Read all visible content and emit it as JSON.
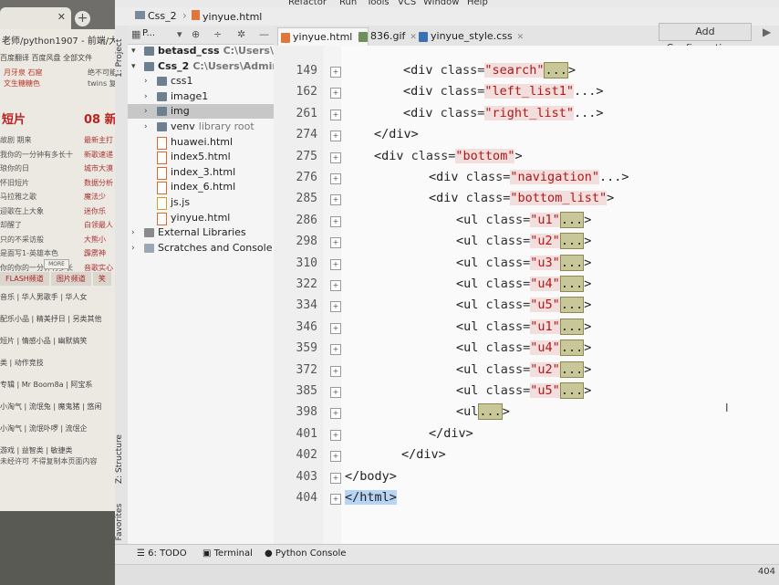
{
  "browser": {
    "url": "老师/python1907 - 前端/大作业",
    "bookmarks": "百度翻译  百度风盘 全部文件",
    "side_links": [
      "月牙泉 石窟",
      "文生糖糖色"
    ],
    "side_links_right": [
      "绝不可能",
      "twins 复"
    ],
    "header_left": "短片",
    "header_right": "08 新",
    "rows": [
      {
        "l": "故剧 期来",
        "r": "最新主打"
      },
      {
        "l": "我你的一分钟有多长十",
        "r": "新歌速递"
      },
      {
        "l": "琅你的日",
        "r": "城市大漠"
      },
      {
        "l": "怀旧短片",
        "r": "数据分析"
      },
      {
        "l": "马拉雅之歌",
        "r": "魔法少"
      },
      {
        "l": "迎歌在上大象",
        "r": "迷你乐"
      },
      {
        "l": "却醒了",
        "r": "白领最人"
      },
      {
        "l": "只的不采访般",
        "r": "大熊小"
      },
      {
        "l": "是面写1-英雄本色",
        "r": "霹雳神"
      },
      {
        "l": "你的你的一分钟有多长",
        "r": "音歌实心"
      }
    ],
    "more": "MORE",
    "tabs": [
      "FLASH频道",
      "图片频道",
      "笑"
    ],
    "categories": [
      "音乐 | 华人男歌手 | 华人女",
      "配乐小品 | 精美抒日 | 另类其他",
      "短片 | 情感小品 | 幽默搞笑",
      "类 | 动作竞技",
      "专辑 | Mr Boom8a | 阿宝系",
      "小淘气 | 流氓兔 | 魔鬼猪 | 悠闲",
      "小淘气 | 流氓卟啰 | 流氓企",
      "游戏 | 益智类 | 敏捷类"
    ],
    "footer": "未经许可 不得复制本页面内容"
  },
  "ide": {
    "menu": [
      "Refactor",
      "Run",
      "Tools",
      "VCS",
      "Window",
      "Help"
    ],
    "breadcrumb": [
      "Css_2",
      "yinyue.html"
    ],
    "project_label": "P...",
    "tree": [
      {
        "name": "betasd_css",
        "path": "C:\\Users\\",
        "type": "project",
        "bold": true
      },
      {
        "name": "Css_2",
        "path": "C:\\Users\\Admir",
        "type": "project",
        "bold": true
      },
      {
        "name": "css1",
        "type": "folder"
      },
      {
        "name": "image1",
        "type": "folder"
      },
      {
        "name": "img",
        "type": "folder",
        "selected": true
      },
      {
        "name": "venv",
        "path": "library root",
        "type": "folder"
      },
      {
        "name": "huawei.html",
        "type": "html"
      },
      {
        "name": "index5.html",
        "type": "html"
      },
      {
        "name": "index_3.html",
        "type": "html"
      },
      {
        "name": "index_6.html",
        "type": "html"
      },
      {
        "name": "js.js",
        "type": "js"
      },
      {
        "name": "yinyue.html",
        "type": "html"
      },
      {
        "name": "External Libraries",
        "type": "lib"
      },
      {
        "name": "Scratches and Console",
        "type": "scratch"
      }
    ],
    "editor_tabs": [
      "yinyue.html",
      "836.gif",
      "yinyue_style.css"
    ],
    "add_configuration": "Add Configuration...",
    "left_strip_tabs": [
      "1: Project",
      "Z: Structure",
      "2: Favorites"
    ],
    "code_lines": [
      {
        "num": "149",
        "indent": 68,
        "parts": [
          [
            "t",
            "<div "
          ],
          [
            "a",
            "class="
          ],
          [
            "v",
            "\"search\""
          ],
          [
            "d",
            "..."
          ],
          [
            "t",
            ">"
          ]
        ]
      },
      {
        "num": "162",
        "indent": 68,
        "parts": [
          [
            "t",
            "<div "
          ],
          [
            "a",
            "class="
          ],
          [
            "v",
            "\"left_list1\""
          ],
          [
            "t",
            "...>"
          ]
        ]
      },
      {
        "num": "261",
        "indent": 68,
        "parts": [
          [
            "t",
            "<div "
          ],
          [
            "a",
            "class="
          ],
          [
            "v",
            "\"right_list\""
          ],
          [
            "t",
            "...>"
          ]
        ]
      },
      {
        "num": "274",
        "indent": 36,
        "parts": [
          [
            "t",
            "</div>"
          ]
        ]
      },
      {
        "num": "275",
        "indent": 36,
        "parts": [
          [
            "t",
            "<div "
          ],
          [
            "a",
            "class="
          ],
          [
            "v",
            "\"bottom\""
          ],
          [
            "t",
            ">"
          ]
        ]
      },
      {
        "num": "276",
        "indent": 96,
        "parts": [
          [
            "t",
            "<div "
          ],
          [
            "a",
            "class="
          ],
          [
            "v",
            "\"navigation\""
          ],
          [
            "t",
            "...>"
          ]
        ]
      },
      {
        "num": "285",
        "indent": 96,
        "parts": [
          [
            "t",
            "<div "
          ],
          [
            "a",
            "class="
          ],
          [
            "v",
            "\"bottom_list\""
          ],
          [
            "t",
            ">"
          ]
        ]
      },
      {
        "num": "286",
        "indent": 126,
        "parts": [
          [
            "t",
            "<ul "
          ],
          [
            "a",
            "class="
          ],
          [
            "v",
            "\"u1\""
          ],
          [
            "d",
            "..."
          ],
          [
            "t",
            ">"
          ]
        ]
      },
      {
        "num": "298",
        "indent": 126,
        "parts": [
          [
            "t",
            "<ul "
          ],
          [
            "a",
            "class="
          ],
          [
            "v",
            "\"u2\""
          ],
          [
            "d",
            "..."
          ],
          [
            "t",
            ">"
          ]
        ]
      },
      {
        "num": "310",
        "indent": 126,
        "parts": [
          [
            "t",
            "<ul "
          ],
          [
            "a",
            "class="
          ],
          [
            "v",
            "\"u3\""
          ],
          [
            "d",
            "..."
          ],
          [
            "t",
            ">"
          ]
        ]
      },
      {
        "num": "322",
        "indent": 126,
        "parts": [
          [
            "t",
            "<ul "
          ],
          [
            "a",
            "class="
          ],
          [
            "v",
            "\"u4\""
          ],
          [
            "d",
            "..."
          ],
          [
            "t",
            ">"
          ]
        ]
      },
      {
        "num": "334",
        "indent": 126,
        "parts": [
          [
            "t",
            "<ul "
          ],
          [
            "a",
            "class="
          ],
          [
            "v",
            "\"u5\""
          ],
          [
            "d",
            "..."
          ],
          [
            "t",
            ">"
          ]
        ]
      },
      {
        "num": "346",
        "indent": 126,
        "parts": [
          [
            "t",
            "<ul "
          ],
          [
            "a",
            "class="
          ],
          [
            "v",
            "\"u1\""
          ],
          [
            "d",
            "..."
          ],
          [
            "t",
            ">"
          ]
        ]
      },
      {
        "num": "359",
        "indent": 126,
        "parts": [
          [
            "t",
            "<ul "
          ],
          [
            "a",
            "class="
          ],
          [
            "v",
            "\"u4\""
          ],
          [
            "d",
            "..."
          ],
          [
            "t",
            ">"
          ]
        ]
      },
      {
        "num": "372",
        "indent": 126,
        "parts": [
          [
            "t",
            "<ul "
          ],
          [
            "a",
            "class="
          ],
          [
            "v",
            "\"u2\""
          ],
          [
            "d",
            "..."
          ],
          [
            "t",
            ">"
          ]
        ]
      },
      {
        "num": "385",
        "indent": 126,
        "parts": [
          [
            "t",
            "<ul "
          ],
          [
            "a",
            "class="
          ],
          [
            "v",
            "\"u5\""
          ],
          [
            "d",
            "..."
          ],
          [
            "t",
            ">"
          ]
        ]
      },
      {
        "num": "398",
        "indent": 126,
        "parts": [
          [
            "t",
            "<ul"
          ],
          [
            "d",
            "..."
          ],
          [
            "t",
            ">"
          ]
        ]
      },
      {
        "num": "401",
        "indent": 96,
        "parts": [
          [
            "t",
            "</div>"
          ]
        ]
      },
      {
        "num": "402",
        "indent": 66,
        "parts": [
          [
            "t",
            "</div>"
          ]
        ]
      },
      {
        "num": "403",
        "indent": 4,
        "parts": [
          [
            "t",
            "</body>"
          ]
        ]
      },
      {
        "num": "404",
        "indent": 4,
        "parts": [
          [
            "s",
            "</html>"
          ]
        ]
      }
    ],
    "bottom_tools": [
      "6: TODO",
      "Terminal",
      "Python Console"
    ],
    "status_right": "404"
  }
}
